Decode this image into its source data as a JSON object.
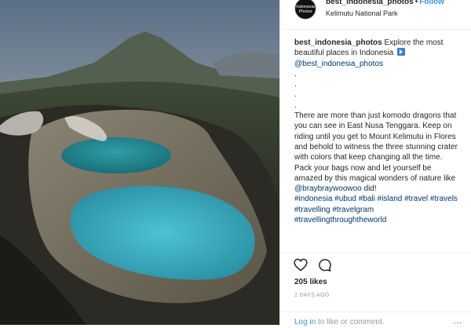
{
  "post": {
    "username": "best_indonesia_photos",
    "follow_label": "Follow",
    "location": "Kelimutu National Park",
    "avatar_text": "Indonesia Photos"
  },
  "caption": {
    "username": "best_indonesia_photos",
    "intro": "Explore the most beautiful places in Indonesia",
    "mention_account": "@best_indonesia_photos",
    "dots": [
      ".",
      ".",
      ".",
      "."
    ],
    "body": "There are more than just komodo dragons that you can see in East Nusa Tenggara. Keep on riding until you get to Mount Kelimutu in Flores and behold to witness the three stunning crater with colors that keep changing all the time. Pack your bags now and let yourself be amazed by this magical wonders of nature like",
    "mention_credit": "@braybraywoowoo",
    "credit_suffix": " did!",
    "hashtags": "#indonesia #ubud #bali #island #travel #travels #travelling #travelgram #travellingthroughtheworld"
  },
  "engagement": {
    "likes": "205 likes",
    "time_ago": "2 DAYS AGO"
  },
  "footer": {
    "login_link": "Log in",
    "login_suffix": " to like or comment.",
    "more": "..."
  },
  "icons": {
    "like": "heart-icon",
    "comment": "comment-icon",
    "options": "more-icon",
    "caption_emoji": "play-icon"
  },
  "colors": {
    "link_blue": "#3897f0",
    "text": "#262626",
    "muted": "#999999",
    "crater_lake": "#3fb6c9"
  }
}
